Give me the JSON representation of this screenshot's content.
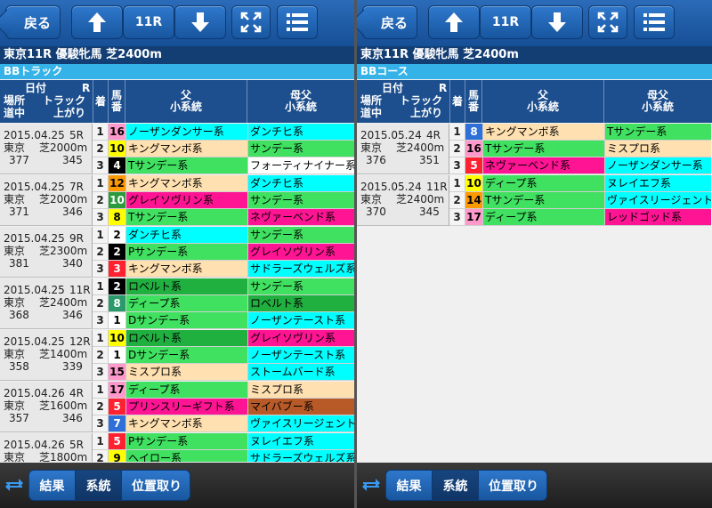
{
  "colors": {
    "header": "#164f96",
    "accent": "#35b3e8",
    "cell": {
      "cyan": "#00ffff",
      "peach": "#ffe0b0",
      "green": "#40e060",
      "white": "#ffffff",
      "magenta": "#ff1493",
      "lime": "#b8ff60",
      "darkgreen": "#20b040",
      "purple": "#dd66ff",
      "brown": "#b85a28",
      "red": "#ff2030"
    }
  },
  "panels": [
    {
      "toolbar": {
        "back_label": "戻る",
        "race_label": "11R"
      },
      "race_title": "東京11R 優駿牝馬 芝2400m",
      "section_title": "BBトラック",
      "header": {
        "meta_date": "日付",
        "meta_r": "R",
        "meta_venue": "場所",
        "meta_track": "トラック",
        "meta_mid": "道中",
        "meta_last": "上がり",
        "rank": "着",
        "num1": "馬",
        "num2": "番",
        "sire1": "父",
        "sire2": "小系統",
        "dam1": "母父",
        "dam2": "小系統"
      },
      "groups": [
        {
          "date": "2015.04.25",
          "race": "5R",
          "venue": "東京",
          "track": "芝2000m",
          "mid": "377",
          "last": "345",
          "rows": [
            {
              "rank": "1",
              "num": "16",
              "numbg": "#ff99cc",
              "numfg": "#000",
              "sire": "ノーザンダンサー系",
              "sirebg": "#00ffff",
              "dam": "ダンチヒ系",
              "dambg": "#00ffff"
            },
            {
              "rank": "2",
              "num": "10",
              "numbg": "#ffff00",
              "numfg": "#000",
              "sire": "キングマンボ系",
              "sirebg": "#ffe0b0",
              "dam": "サンデー系",
              "dambg": "#40e060"
            },
            {
              "rank": "3",
              "num": "4",
              "numbg": "#000000",
              "numfg": "#fff",
              "sire": "Tサンデー系",
              "sirebg": "#40e060",
              "dam": "フォーティナイナー系",
              "dambg": "#ffffff"
            }
          ]
        },
        {
          "date": "2015.04.25",
          "race": "7R",
          "venue": "東京",
          "track": "芝2000m",
          "mid": "371",
          "last": "346",
          "rows": [
            {
              "rank": "1",
              "num": "12",
              "numbg": "#ff9900",
              "numfg": "#000",
              "sire": "キングマンボ系",
              "sirebg": "#ffe0b0",
              "dam": "ダンチヒ系",
              "dambg": "#00ffff"
            },
            {
              "rank": "2",
              "num": "10",
              "numbg": "#2a9a3a",
              "numfg": "#fff",
              "sire": "グレイソヴリン系",
              "sirebg": "#ff1493",
              "dam": "サンデー系",
              "dambg": "#40e060"
            },
            {
              "rank": "3",
              "num": "8",
              "numbg": "#ffff00",
              "numfg": "#000",
              "sire": "Tサンデー系",
              "sirebg": "#40e060",
              "dam": "ネヴァーベンド系",
              "dambg": "#ff1493"
            }
          ]
        },
        {
          "date": "2015.04.25",
          "race": "9R",
          "venue": "東京",
          "track": "芝2300m",
          "mid": "381",
          "last": "340",
          "rows": [
            {
              "rank": "1",
              "num": "2",
              "numbg": "#ffffff",
              "numfg": "#000",
              "sire": "ダンチヒ系",
              "sirebg": "#00ffff",
              "dam": "サンデー系",
              "dambg": "#40e060"
            },
            {
              "rank": "2",
              "num": "2",
              "numbg": "#000000",
              "numfg": "#fff",
              "sire": "Pサンデー系",
              "sirebg": "#40e060",
              "dam": "グレイソヴリン系",
              "dambg": "#ff1493"
            },
            {
              "rank": "3",
              "num": "3",
              "numbg": "#ff2030",
              "numfg": "#fff",
              "sire": "キングマンボ系",
              "sirebg": "#ffe0b0",
              "dam": "サドラーズウェルズ系",
              "dambg": "#00ffff"
            }
          ]
        },
        {
          "date": "2015.04.25",
          "race": "11R",
          "venue": "東京",
          "track": "芝2400m",
          "mid": "368",
          "last": "346",
          "rows": [
            {
              "rank": "1",
              "num": "2",
              "numbg": "#000000",
              "numfg": "#fff",
              "sire": "ロベルト系",
              "sirebg": "#20b040",
              "dam": "サンデー系",
              "dambg": "#40e060"
            },
            {
              "rank": "2",
              "num": "8",
              "numbg": "#2a9a6a",
              "numfg": "#fff",
              "sire": "ディープ系",
              "sirebg": "#40e060",
              "dam": "ロベルト系",
              "dambg": "#20b040"
            },
            {
              "rank": "3",
              "num": "1",
              "numbg": "#ffffff",
              "numfg": "#000",
              "sire": "Dサンデー系",
              "sirebg": "#40e060",
              "dam": "ノーザンテースト系",
              "dambg": "#00ffff"
            }
          ]
        },
        {
          "date": "2015.04.25",
          "race": "12R",
          "venue": "東京",
          "track": "芝1400m",
          "mid": "358",
          "last": "339",
          "rows": [
            {
              "rank": "1",
              "num": "10",
              "numbg": "#ffff00",
              "numfg": "#000",
              "sire": "ロベルト系",
              "sirebg": "#20b040",
              "dam": "グレイソヴリン系",
              "dambg": "#ff1493"
            },
            {
              "rank": "2",
              "num": "1",
              "numbg": "#ffffff",
              "numfg": "#000",
              "sire": "Dサンデー系",
              "sirebg": "#40e060",
              "dam": "ノーザンテースト系",
              "dambg": "#00ffff"
            },
            {
              "rank": "3",
              "num": "15",
              "numbg": "#ff99cc",
              "numfg": "#000",
              "sire": "ミスプロ系",
              "sirebg": "#ffe0b0",
              "dam": "ストームバード系",
              "dambg": "#00ffff"
            }
          ]
        },
        {
          "date": "2015.04.26",
          "race": "4R",
          "venue": "東京",
          "track": "芝1600m",
          "mid": "357",
          "last": "346",
          "rows": [
            {
              "rank": "1",
              "num": "17",
              "numbg": "#ff99cc",
              "numfg": "#000",
              "sire": "ディープ系",
              "sirebg": "#40e060",
              "dam": "ミスプロ系",
              "dambg": "#ffe0b0"
            },
            {
              "rank": "2",
              "num": "5",
              "numbg": "#ff2030",
              "numfg": "#fff",
              "sire": "プリンスリーギフト系",
              "sirebg": "#ff1493",
              "dam": "マイバブー系",
              "dambg": "#b85a28"
            },
            {
              "rank": "3",
              "num": "7",
              "numbg": "#2f6fd8",
              "numfg": "#fff",
              "sire": "キングマンボ系",
              "sirebg": "#ffe0b0",
              "dam": "ヴァイスリージェント系",
              "dambg": "#00ffff"
            }
          ]
        },
        {
          "date": "2015.04.26",
          "race": "5R",
          "venue": "東京",
          "track": "芝1800m",
          "mid": "",
          "last": "",
          "rows": [
            {
              "rank": "1",
              "num": "5",
              "numbg": "#ff2030",
              "numfg": "#fff",
              "sire": "Pサンデー系",
              "sirebg": "#40e060",
              "dam": "ヌレイエフ系",
              "dambg": "#00ffff"
            },
            {
              "rank": "2",
              "num": "9",
              "numbg": "#ffff00",
              "numfg": "#000",
              "sire": "ヘイロー系",
              "sirebg": "#40e060",
              "dam": "サドラーズウェルズ系",
              "dambg": "#00ffff"
            }
          ]
        }
      ],
      "bottom": {
        "tab1": "結果",
        "tab2": "系統",
        "tab3": "位置取り"
      }
    },
    {
      "toolbar": {
        "back_label": "戻る",
        "race_label": "11R"
      },
      "race_title": "東京11R 優駿牝馬 芝2400m",
      "section_title": "BBコース",
      "header": {
        "meta_date": "日付",
        "meta_r": "R",
        "meta_venue": "場所",
        "meta_track": "トラック",
        "meta_mid": "道中",
        "meta_last": "上がり",
        "rank": "着",
        "num1": "馬",
        "num2": "番",
        "sire1": "父",
        "sire2": "小系統",
        "dam1": "母父",
        "dam2": "小系統"
      },
      "groups": [
        {
          "date": "2015.05.24",
          "race": "4R",
          "venue": "東京",
          "track": "芝2400m",
          "mid": "376",
          "last": "351",
          "rows": [
            {
              "rank": "1",
              "num": "8",
              "numbg": "#2f6fd8",
              "numfg": "#fff",
              "sire": "キングマンボ系",
              "sirebg": "#ffe0b0",
              "dam": "Tサンデー系",
              "dambg": "#40e060"
            },
            {
              "rank": "2",
              "num": "16",
              "numbg": "#ff99cc",
              "numfg": "#000",
              "sire": "Tサンデー系",
              "sirebg": "#40e060",
              "dam": "ミスプロ系",
              "dambg": "#ffe0b0"
            },
            {
              "rank": "3",
              "num": "5",
              "numbg": "#ff2030",
              "numfg": "#fff",
              "sire": "ネヴァーベンド系",
              "sirebg": "#ff1493",
              "dam": "ノーザンダンサー系",
              "dambg": "#00ffff"
            }
          ]
        },
        {
          "date": "2015.05.24",
          "race": "11R",
          "venue": "東京",
          "track": "芝2400m",
          "mid": "370",
          "last": "345",
          "rows": [
            {
              "rank": "1",
              "num": "10",
              "numbg": "#ffff00",
              "numfg": "#000",
              "sire": "ディープ系",
              "sirebg": "#40e060",
              "dam": "ヌレイエフ系",
              "dambg": "#00ffff"
            },
            {
              "rank": "2",
              "num": "14",
              "numbg": "#ff9900",
              "numfg": "#000",
              "sire": "Tサンデー系",
              "sirebg": "#40e060",
              "dam": "ヴァイスリージェント系",
              "dambg": "#00ffff"
            },
            {
              "rank": "3",
              "num": "17",
              "numbg": "#ff99cc",
              "numfg": "#000",
              "sire": "ディープ系",
              "sirebg": "#40e060",
              "dam": "レッドゴッド系",
              "dambg": "#ff1493"
            }
          ]
        }
      ],
      "bottom": {
        "tab1": "結果",
        "tab2": "系統",
        "tab3": "位置取り"
      }
    }
  ]
}
